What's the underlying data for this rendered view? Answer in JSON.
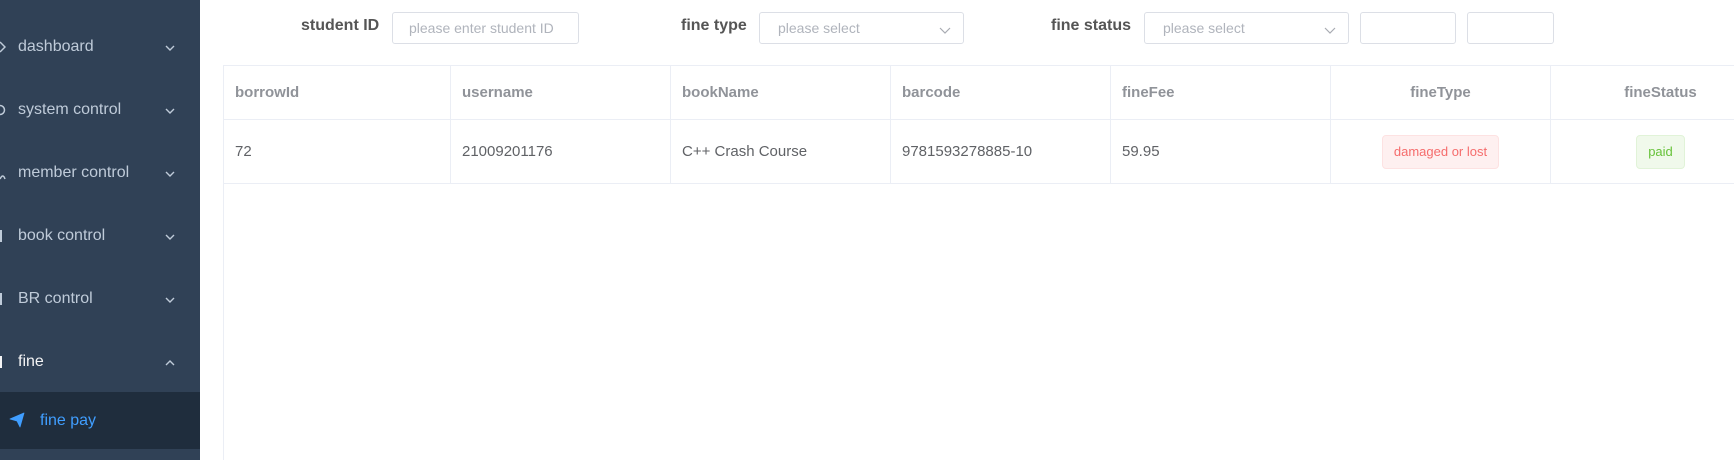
{
  "sidebar": {
    "items": [
      {
        "label": "dashboard",
        "icon": "dashboard-icon"
      },
      {
        "label": "system control",
        "icon": "system-icon"
      },
      {
        "label": "member control",
        "icon": "member-icon"
      },
      {
        "label": "book control",
        "icon": "book-icon"
      },
      {
        "label": "BR control",
        "icon": "br-icon"
      },
      {
        "label": "fine",
        "icon": "fine-icon",
        "expanded": true
      }
    ],
    "submenu": {
      "label": "fine pay",
      "icon": "paper-plane-icon",
      "active": true
    }
  },
  "filters": {
    "student_id": {
      "label": "student ID",
      "placeholder": "please enter student ID"
    },
    "fine_type": {
      "label": "fine type",
      "placeholder": "please select"
    },
    "fine_status": {
      "label": "fine status",
      "placeholder": "please select"
    },
    "extra_boxes": [
      "",
      ""
    ]
  },
  "table": {
    "columns": [
      "borrowId",
      "username",
      "bookName",
      "barcode",
      "fineFee",
      "fineType",
      "fineStatus"
    ],
    "rows": [
      {
        "borrowId": "72",
        "username": "21009201176",
        "bookName": "C++ Crash Course",
        "barcode": "9781593278885-10",
        "fineFee": "59.95",
        "fineType": "damaged or lost",
        "fineStatus": "paid"
      }
    ]
  },
  "colors": {
    "sidebar_bg": "#304156",
    "submenu_bg": "#1f2d3d",
    "accent": "#409eff",
    "danger": "#f56c6c",
    "success": "#67c23a"
  }
}
